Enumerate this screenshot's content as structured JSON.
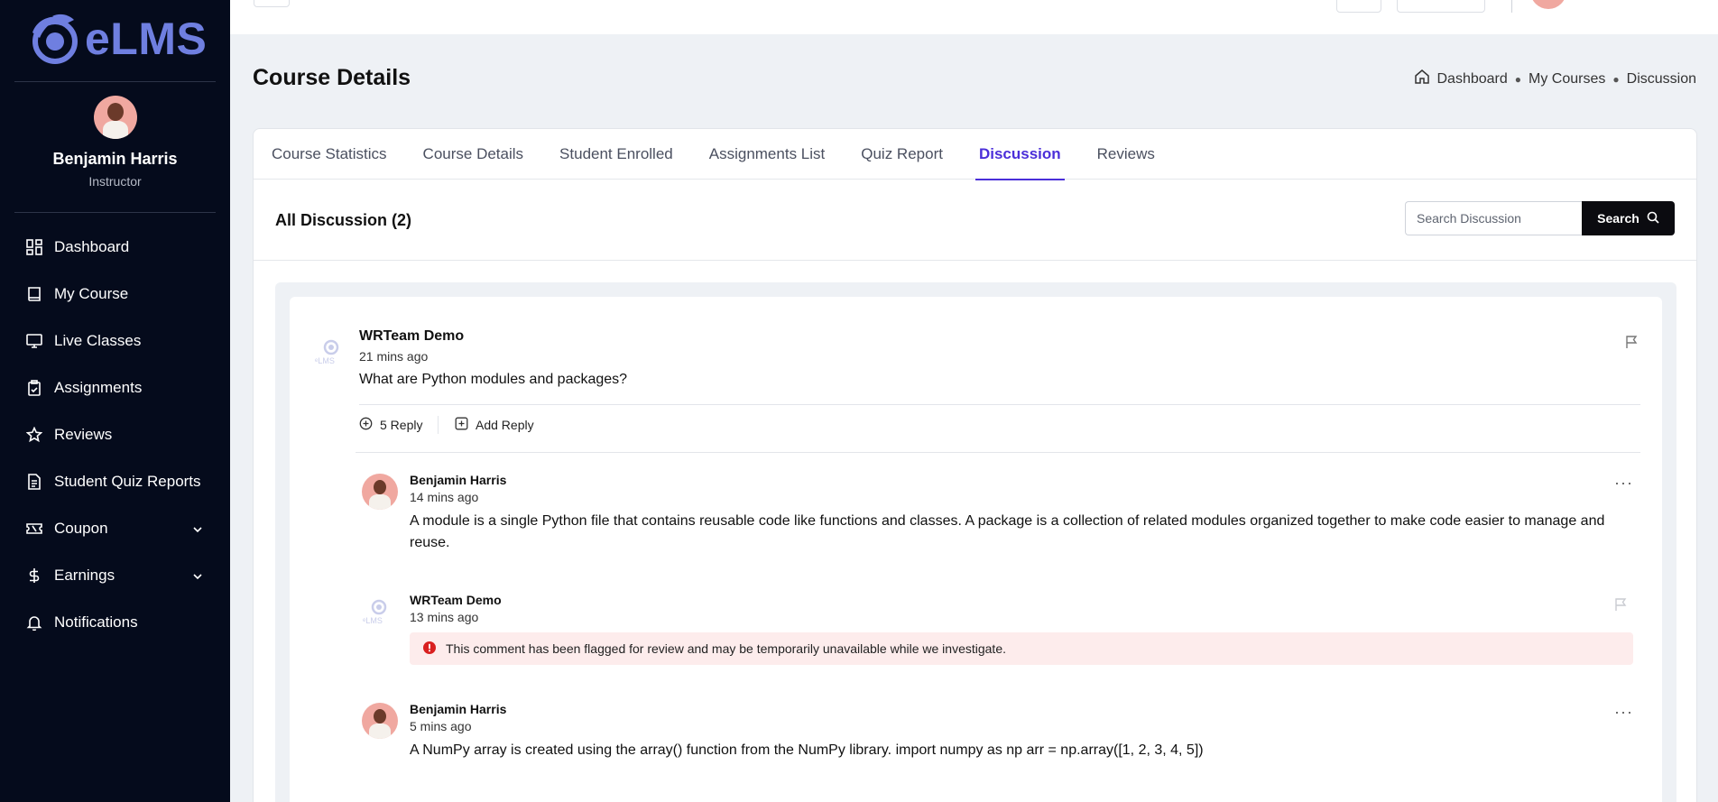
{
  "app": {
    "logo_text": "eLMS"
  },
  "profile": {
    "name": "Benjamin Harris",
    "role": "Instructor"
  },
  "sidebar": {
    "items": [
      {
        "label": "Dashboard",
        "icon": "dashboard-icon"
      },
      {
        "label": "My Course",
        "icon": "book-icon"
      },
      {
        "label": "Live Classes",
        "icon": "monitor-icon"
      },
      {
        "label": "Assignments",
        "icon": "clipboard-icon"
      },
      {
        "label": "Reviews",
        "icon": "star-icon"
      },
      {
        "label": "Student Quiz Reports",
        "icon": "document-icon"
      },
      {
        "label": "Coupon",
        "icon": "ticket-icon",
        "expandable": true
      },
      {
        "label": "Earnings",
        "icon": "dollar-icon",
        "expandable": true
      },
      {
        "label": "Notifications",
        "icon": "bell-icon"
      }
    ]
  },
  "page": {
    "title": "Course Details",
    "breadcrumb": [
      "Dashboard",
      "My Courses",
      "Discussion"
    ]
  },
  "tabs": [
    {
      "label": "Course Statistics",
      "active": false
    },
    {
      "label": "Course Details",
      "active": false
    },
    {
      "label": "Student Enrolled",
      "active": false
    },
    {
      "label": "Assignments List",
      "active": false
    },
    {
      "label": "Quiz Report",
      "active": false
    },
    {
      "label": "Discussion",
      "active": true
    },
    {
      "label": "Reviews",
      "active": false
    }
  ],
  "discussion": {
    "heading": "All Discussion (2)",
    "search_placeholder": "Search Discussion",
    "search_label": "Search",
    "post": {
      "author": "WRTeam Demo",
      "time": "21 mins ago",
      "text": "What are Python modules and packages?",
      "reply_count_label": "5 Reply",
      "add_reply_label": "Add Reply"
    },
    "replies": [
      {
        "author": "Benjamin Harris",
        "time": "14 mins ago",
        "text": "A module is a single Python file that contains reusable code like functions and classes. A package is a collection of related modules organized together to make code easier to manage and reuse."
      },
      {
        "author": "WRTeam Demo",
        "time": "13 mins ago",
        "flag_message": "This comment has been flagged for review and may be temporarily unavailable while we investigate."
      },
      {
        "author": "Benjamin Harris",
        "time": "5 mins ago",
        "text": "A NumPy array is created using the array() function from the NumPy library. import numpy as np arr = np.array([1, 2, 3, 4, 5])"
      }
    ]
  },
  "colors": {
    "sidebar_bg": "#050b1c",
    "accent": "#4b2fd9",
    "brand": "#6f7fe0",
    "flag_bg": "#fdecec",
    "flag_icon": "#d92020"
  }
}
